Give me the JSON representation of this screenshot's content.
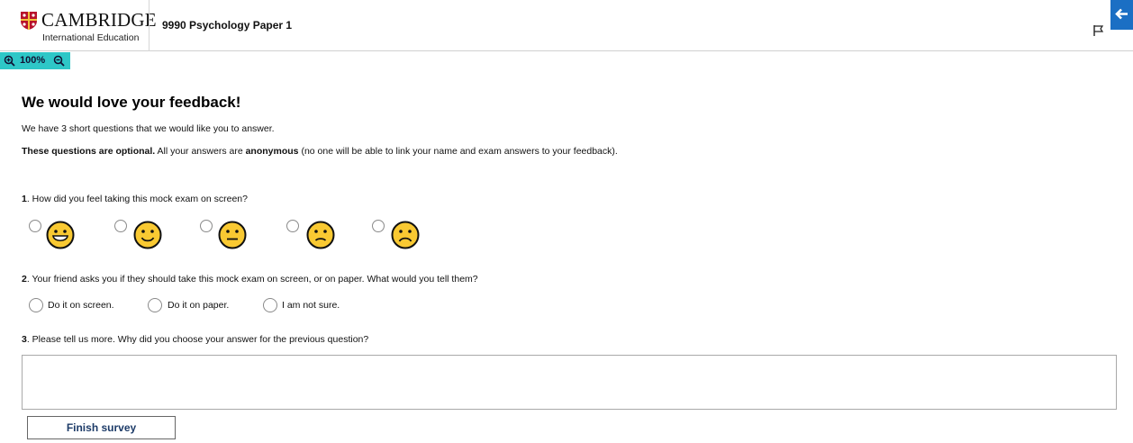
{
  "header": {
    "logo_name": "CAMBRIDGE",
    "logo_sub": "International Education",
    "paper_title": "9990 Psychology Paper 1",
    "flag_icon": "flag-icon",
    "back_icon": "arrow-left-icon",
    "back_color": "#1b6fc4"
  },
  "zoom": {
    "level": "100%",
    "color": "#2ec7c7"
  },
  "survey": {
    "title": "We would love your feedback!",
    "intro": "We have 3 short questions that we would like you to answer.",
    "optional_bold": "These questions are optional.",
    "optional_mid": " All your answers are ",
    "anonymous_bold": "anonymous",
    "optional_end": " (no one will be able to link your name and exam answers to your feedback).",
    "q1": {
      "number": "1",
      "text": ". How did you feel taking this mock exam on screen?"
    },
    "faces": [
      "grinning-face-icon",
      "slightly-smiling-face-icon",
      "neutral-face-icon",
      "slightly-frowning-face-icon",
      "frowning-face-icon"
    ],
    "q2": {
      "number": "2",
      "text": ". Your friend asks you if they should take this mock exam on screen, or on paper. What would you tell them?",
      "options": [
        "Do it on screen.",
        "Do it on paper.",
        "I am not sure."
      ]
    },
    "q3": {
      "number": "3",
      "text": ". Please tell us more. Why did you choose your answer for the previous question?"
    },
    "finish_label": "Finish survey"
  }
}
